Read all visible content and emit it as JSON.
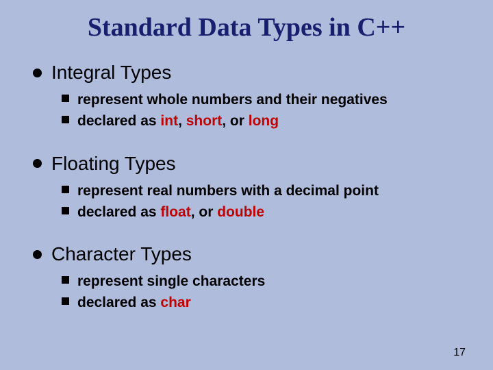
{
  "title": "Standard Data Types in C++",
  "sections": [
    {
      "heading": "Integral Types",
      "items": [
        {
          "prefix": "represent whole numbers and their negatives",
          "keywords": []
        },
        {
          "prefix": "declared as ",
          "keywords": [
            "int",
            ",  ",
            "short",
            ", or ",
            "long"
          ]
        }
      ]
    },
    {
      "heading": "Floating Types",
      "items": [
        {
          "prefix": "represent real numbers with a decimal point",
          "keywords": []
        },
        {
          "prefix": "declared as ",
          "keywords": [
            "float",
            ", or ",
            "double"
          ]
        }
      ]
    },
    {
      "heading": "Character Types",
      "items": [
        {
          "prefix": "represent single characters",
          "keywords": []
        },
        {
          "prefix": "declared as ",
          "keywords": [
            "char"
          ]
        }
      ]
    }
  ],
  "pageNumber": "17"
}
